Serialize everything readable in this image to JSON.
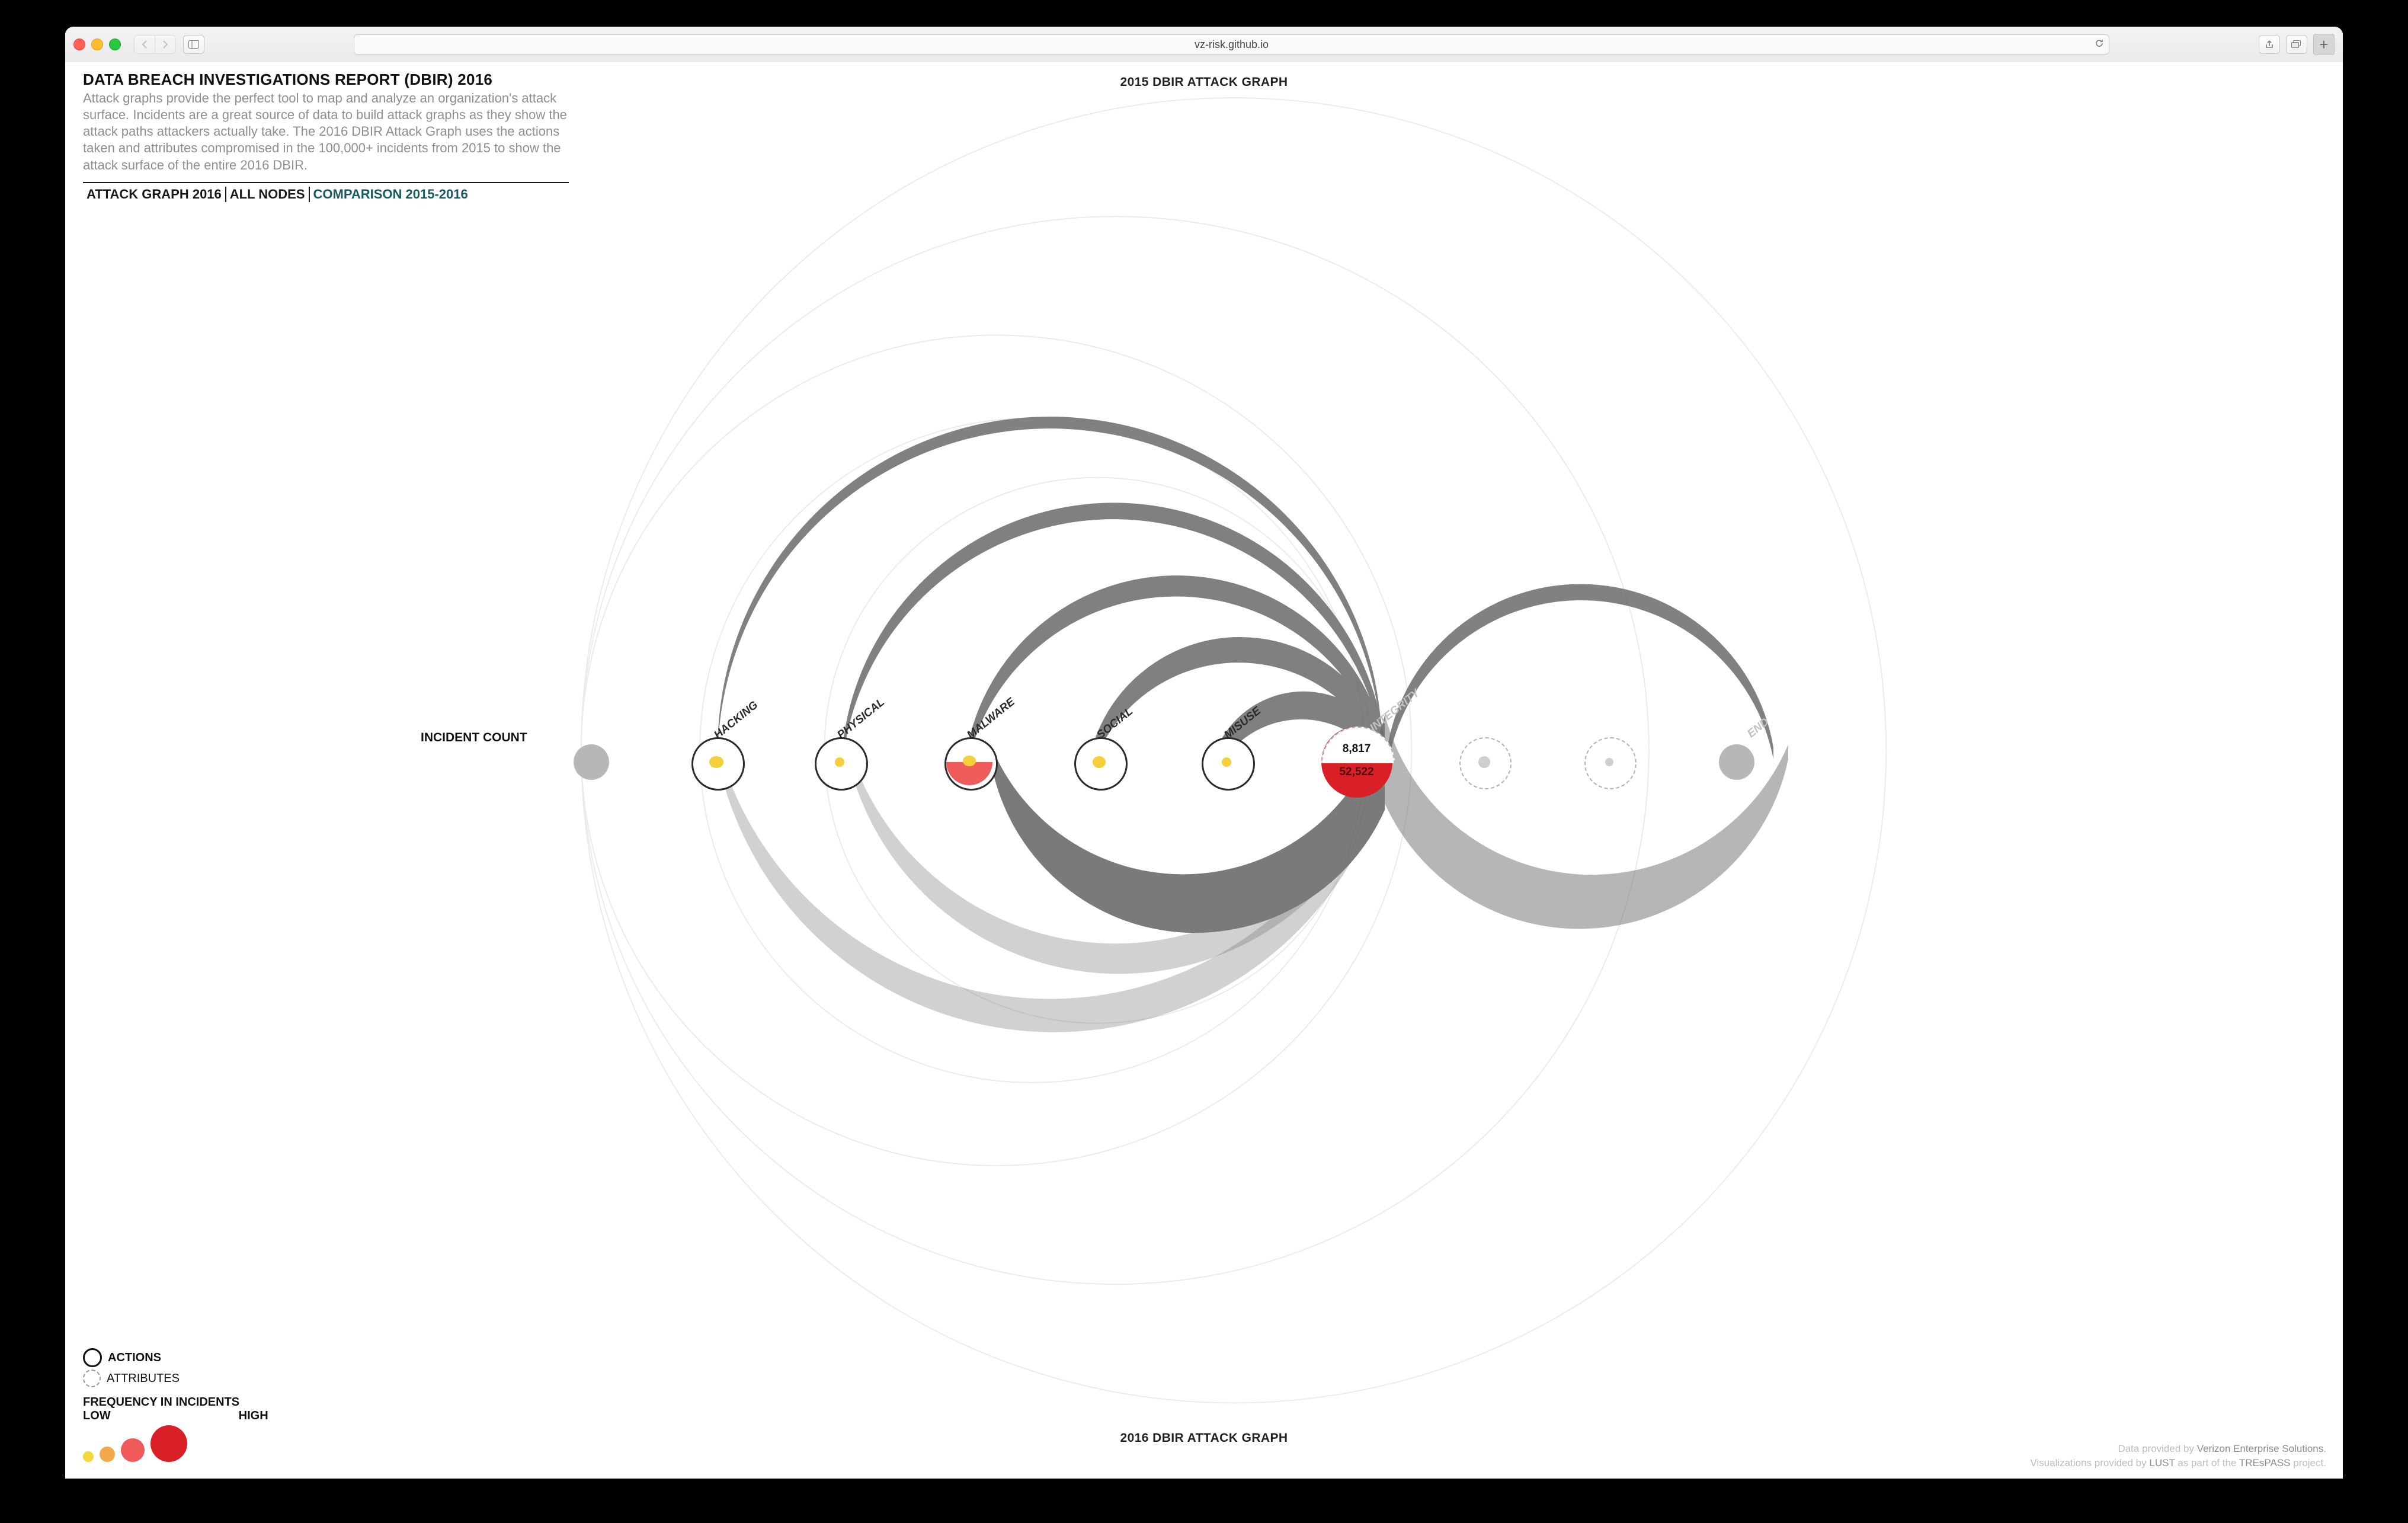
{
  "browser": {
    "url_host": "vz-risk.github.io"
  },
  "header": {
    "title": "DATA BREACH INVESTIGATIONS REPORT (DBIR) 2016",
    "blurb_full": "Attack graphs provide the perfect tool to map and analyze an organization's attack surface. Incidents are a great source of data to build attack graphs as they show the attack paths attackers actually take. The 2016 DBIR Attack Graph uses the actions taken and attributes compromised in the 100,000+ incidents from 2015 to show the attack surface of the entire 2016 DBIR.",
    "tabs": [
      "ATTACK GRAPH 2016",
      "ALL NODES",
      "COMPARISON 2015-2016"
    ],
    "active_tab_index": 2
  },
  "chart_data": {
    "type": "diagram",
    "title_top": "2015 DBIR ATTACK GRAPH",
    "title_bottom": "2016 DBIR ATTACK GRAPH",
    "axis_left_label": "INCIDENT COUNT",
    "nodes": [
      {
        "id": "start",
        "label": "",
        "kind": "terminal"
      },
      {
        "id": "hacking",
        "label": "HACKING",
        "kind": "action",
        "freq": "low-mid"
      },
      {
        "id": "physical",
        "label": "PHYSICAL",
        "kind": "action",
        "freq": "low"
      },
      {
        "id": "malware",
        "label": "MALWARE",
        "kind": "action",
        "freq": "mid",
        "half": {
          "side": "bottom",
          "color": "#ef5a5a",
          "fraction": 0.5
        }
      },
      {
        "id": "social",
        "label": "SOCIAL",
        "kind": "action",
        "freq": "low-mid"
      },
      {
        "id": "misuse",
        "label": "MISUSE",
        "kind": "action",
        "freq": "low"
      },
      {
        "id": "integrity",
        "label": "INTEGRITY",
        "kind": "attribute",
        "value_top": "8,817",
        "value_bottom": "52,522",
        "full": {
          "color": "#d92027"
        }
      },
      {
        "id": "attr2",
        "label": "",
        "kind": "attribute"
      },
      {
        "id": "attr3",
        "label": "",
        "kind": "attribute"
      },
      {
        "id": "end",
        "label": "END",
        "kind": "terminal"
      }
    ],
    "edges_note": "Heavy arcs converge into 'integrity' from hacking/physical/malware/social/misuse; largest flow in 2016 half (bottom) from malware→integrity and integrity→end.",
    "highlight_node": "integrity"
  },
  "legend": {
    "actions": "ACTIONS",
    "attributes": "ATTRIBUTES",
    "freq_title": "FREQUENCY IN INCIDENTS",
    "low": "LOW",
    "high": "HIGH",
    "colors": [
      "#f7d63b",
      "#f4a84a",
      "#ef5a5a",
      "#d92027"
    ]
  },
  "credits": {
    "line1_pre": "Data provided by ",
    "line1_em": "Verizon Enterprise Solutions.",
    "line2_pre": "Visualizations provided by ",
    "line2_em1": "LUST",
    "line2_mid": " as part of the ",
    "line2_em2": "TREsPASS",
    "line2_post": " project."
  }
}
